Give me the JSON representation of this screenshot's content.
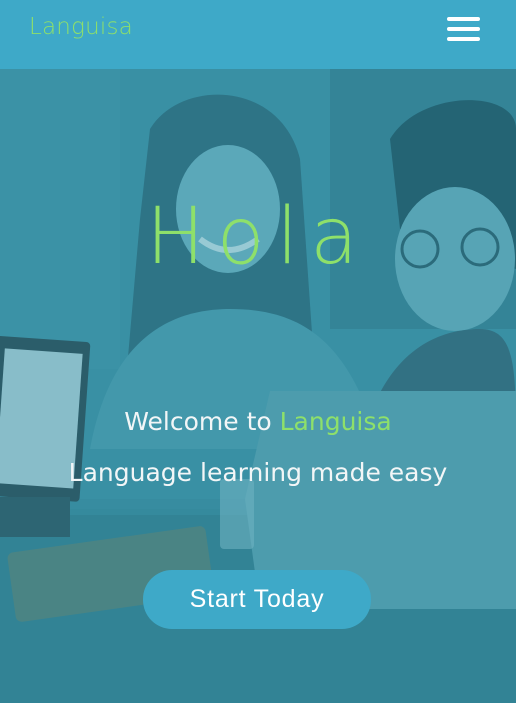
{
  "header": {
    "brand": "Languisa",
    "menu_icon": "hamburger-menu-icon"
  },
  "hero": {
    "greeting": "Hola",
    "welcome_prefix": "Welcome to ",
    "welcome_brand": "Languisa",
    "tagline": "Language learning made easy",
    "cta_label": "Start Today"
  },
  "colors": {
    "header_bg": "#3ea9c8",
    "accent_green": "#8ee06a",
    "button_bg": "#3ea9c8",
    "text_light": "#f2f6f7"
  }
}
